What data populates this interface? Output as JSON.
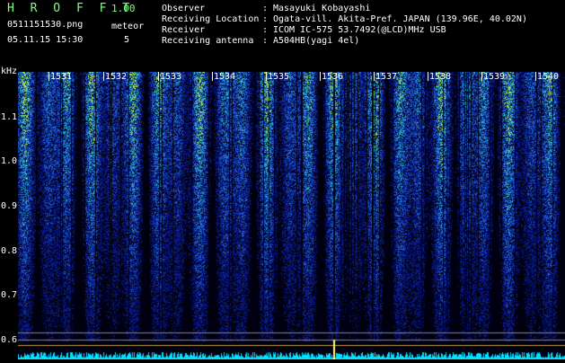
{
  "app": {
    "title": "H R O F F T",
    "version": "1.00"
  },
  "file": {
    "name": "0511151530.png",
    "timestamp": "05.11.15 15:30"
  },
  "meteor": {
    "label": "meteor",
    "count": "5"
  },
  "info": [
    {
      "key": "Observer",
      "value": "Masayuki Kobayashi"
    },
    {
      "key": "Receiving Location",
      "value": "Ogata-vill. Akita-Pref. JAPAN (139.96E, 40.02N)"
    },
    {
      "key": "Receiver",
      "value": "ICOM IC-575 53.7492(@LCD)MHz USB"
    },
    {
      "key": "Receiving antenna",
      "value": "A504HB(yagi 4el)"
    }
  ],
  "spectrogram": {
    "unit": "kHz",
    "freq_ticks": [
      "1.1",
      "1.0",
      "0.9",
      "0.8",
      "0.7",
      "0.6"
    ],
    "time_ticks": [
      "1531",
      "1532",
      "1533",
      "1534",
      "1535",
      "1536",
      "1537",
      "1538",
      "1539",
      "1540"
    ],
    "colors": {
      "background": "#000010",
      "low": "#0a1a8c",
      "mid": "#1f5fd0",
      "high": "#26c0c0",
      "peak": "#b8f040",
      "baseline": "#00e0ff"
    }
  }
}
